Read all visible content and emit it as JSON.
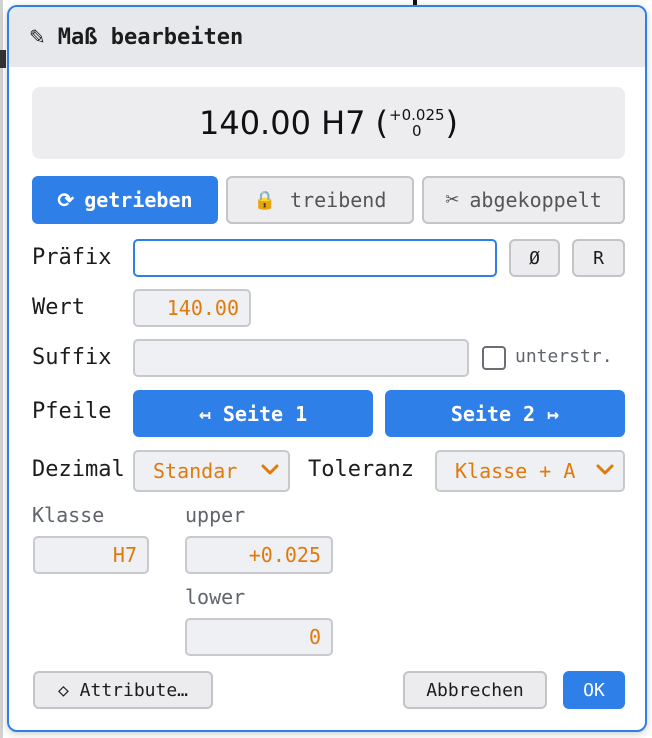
{
  "dialog": {
    "title": "Maß bearbeiten",
    "title_icon": "✎"
  },
  "preview": {
    "nominal": "140.00 H7",
    "paren_open": "(",
    "paren_close": ")",
    "tol_upper": "+0.025",
    "tol_lower": "0"
  },
  "modes": {
    "driven": {
      "icon": "⟳",
      "label": "getrieben"
    },
    "driving": {
      "icon": "🔒",
      "label": "treibend"
    },
    "decoupled": {
      "icon": "✂",
      "label": "abgekoppelt"
    }
  },
  "prefix": {
    "label": "Präfix",
    "value": "",
    "diameter_button": "Ø",
    "radius_button": "R"
  },
  "value": {
    "label": "Wert",
    "value": "140.00"
  },
  "suffix": {
    "label": "Suffix",
    "value": "",
    "underline_label": "unterstr."
  },
  "arrows": {
    "label": "Pfeile",
    "side1": "↤ Seite 1",
    "side2": "Seite 2 ↦"
  },
  "decimal": {
    "label": "Dezimal",
    "selected": "Standar"
  },
  "tolerance": {
    "label": "Toleranz",
    "selected": "Klasse + A"
  },
  "fit": {
    "class_label": "Klasse",
    "class_value": "H7",
    "upper_label": "upper",
    "upper_value": "+0.025",
    "lower_label": "lower",
    "lower_value": "0"
  },
  "footer": {
    "attributes": "◇ Attribute…",
    "cancel": "Abbrechen",
    "ok": "OK"
  },
  "colors": {
    "accent": "#2f7fe8",
    "value_text": "#e07a0b"
  }
}
